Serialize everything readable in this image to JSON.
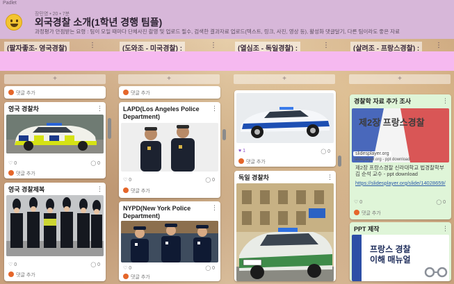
{
  "header": {
    "brand": "Padlet",
    "meta": "장민영 • 20 • 7분",
    "title": "외국경찰 소개(1학년 경행 팀플)",
    "description": "과정평가 안점받는 요령 : 팀이 모일 때마다 단체사진 촬영 및 업로드 필수, 검색한 결과자료 업로드(텍스트, 링크, 사진, 영상 등), 활성화 댓글달기, 다른 팀이라도 좋은 자료"
  },
  "columns": [
    {
      "label": "(팔자좋조- 영국경찰)"
    },
    {
      "label": "(도와조 - 미국경찰) :"
    },
    {
      "label": "(열심조 - 독일경찰) :"
    },
    {
      "label": "(살려조 - 프랑스경찰) :"
    }
  ],
  "common": {
    "add": "+",
    "reply": "댓글 추가",
    "more": "⋮",
    "zero": "0",
    "one": "1"
  },
  "cards": {
    "uk_car": {
      "title": "영국 경찰차"
    },
    "uk_uniform": {
      "title": "영국 경찰제복"
    },
    "lapd": {
      "title": "LAPD(Los Angeles Police Department)"
    },
    "nypd": {
      "title": "NYPD(New York Police Department)"
    },
    "de_car": {
      "title": "독일 경찰차"
    },
    "fr_research": {
      "title": "경찰학 자료 추가 조사",
      "thumb_title": "제2장 프랑스경찰",
      "site": "slidesplayer.org",
      "thumb_caption": "slideplayer.org - ppt download",
      "summary": "제2장 프랑스경찰 신라대학교 법경찰학부 김 순석 교수 - ppt download",
      "url": "https://slidesplayer.org/slide/14028659/"
    },
    "ppt": {
      "title": "PPT 제작",
      "line1": "프랑스 경찰",
      "line2": "이해 매뉴얼"
    }
  },
  "colors": {
    "header_bg": "#d7b7d9",
    "pink_band": "#f6b9f0",
    "reply_icon": "#e5662a",
    "link": "#2a5aa8"
  }
}
